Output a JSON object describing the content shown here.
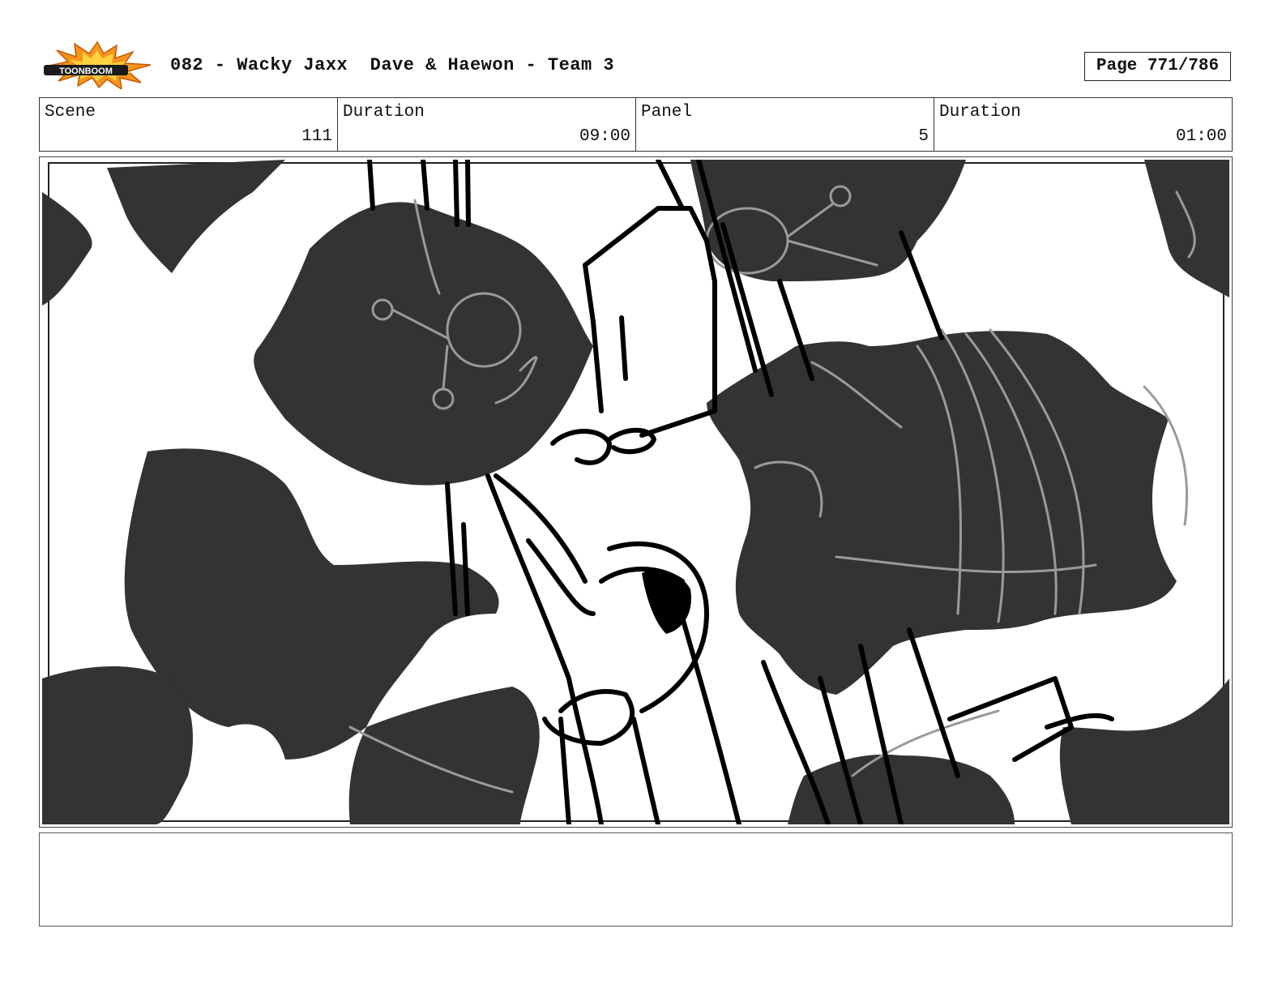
{
  "header": {
    "logo_text": "TOONBOOM",
    "title": "082 - Wacky Jaxx  Dave & Haewon - Team 3",
    "page": "Page 771/786"
  },
  "info": {
    "scene_label": "Scene",
    "scene_value": "111",
    "duration_label": "Duration",
    "duration_value": "09:00",
    "panel_label": "Panel",
    "panel_value": "5",
    "panel_duration_label": "Duration",
    "panel_duration_value": "01:00"
  },
  "notes": {
    "text": ""
  },
  "colors": {
    "shadow_fill": "#333333",
    "sketch_grey": "#9a9a9a",
    "ink": "#000000",
    "logo_orange": "#f7941d"
  }
}
